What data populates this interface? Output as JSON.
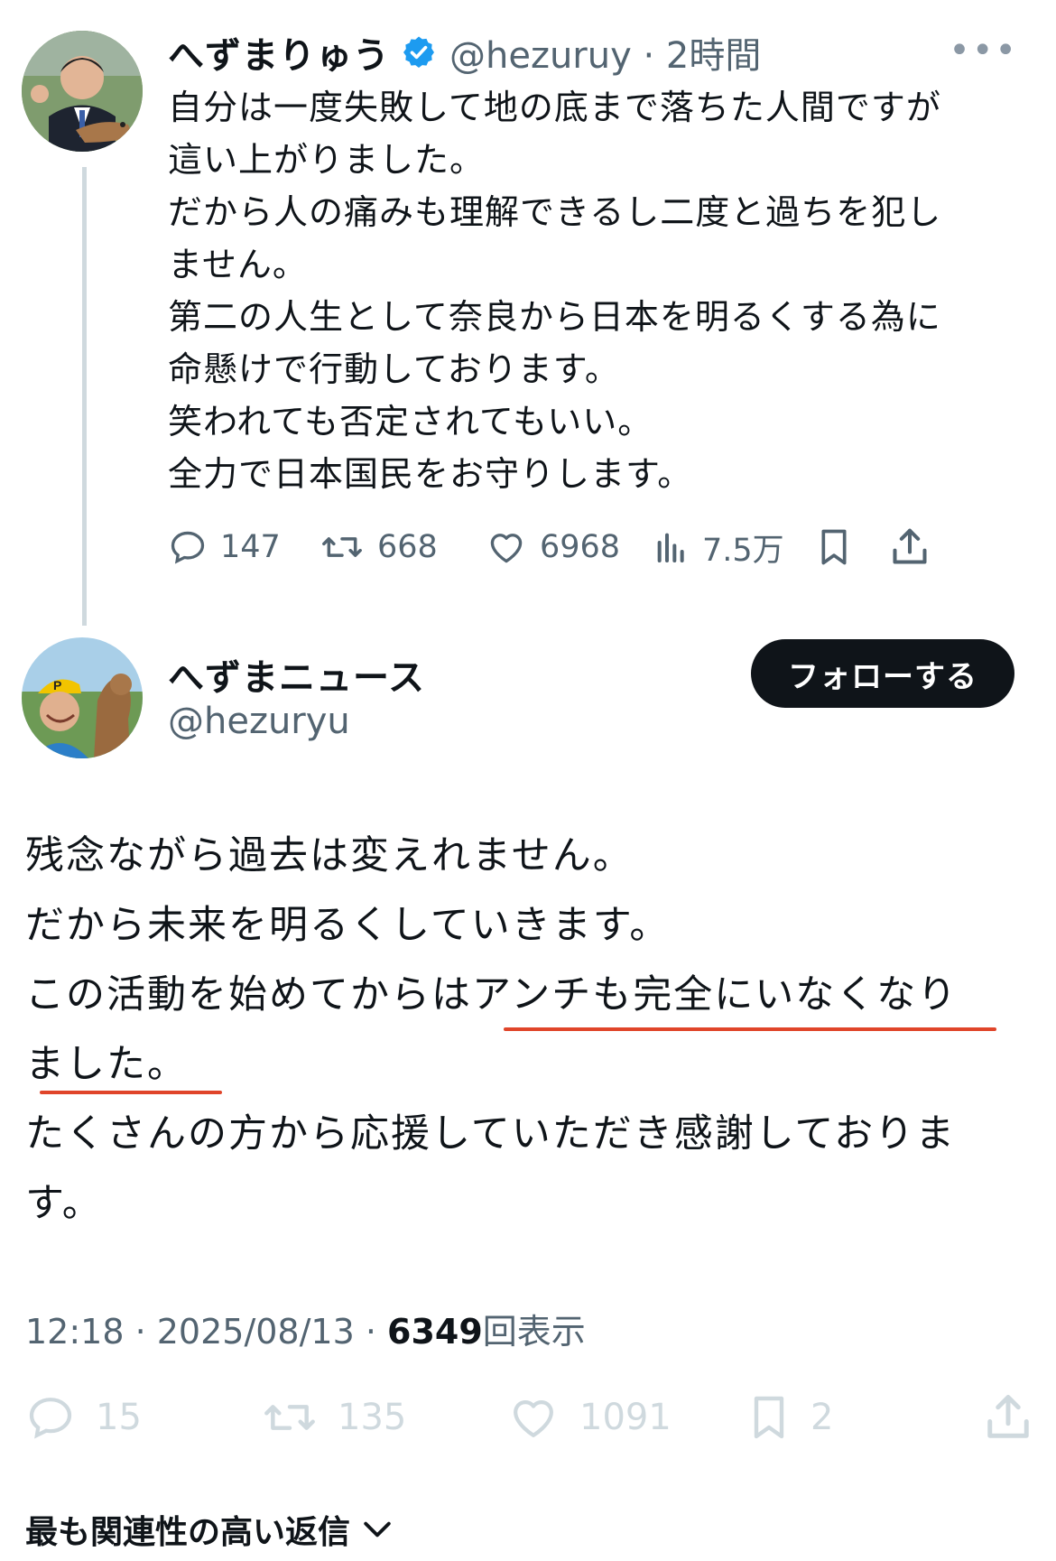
{
  "post1": {
    "display_name": "へずまりゅう",
    "handle_time": "@hezuruy · 2時間",
    "lines": [
      "自分は一度失敗して地の底まで落ちた人間ですが",
      "這い上がりました。",
      "だから人の痛みも理解できるし二度と過ちを犯し",
      "ません。",
      "第二の人生として奈良から日本を明るくする為に",
      "命懸けで行動しております。",
      "笑われても否定されてもいい。",
      "全力で日本国民をお守りします。"
    ],
    "replies": "147",
    "reposts": "668",
    "likes": "6968",
    "views": "7.5万"
  },
  "post2": {
    "display_name": "へずまニュース",
    "handle": "@hezuryu",
    "follow_label": "フォローする",
    "lines": [
      "残念ながら過去は変えれません。",
      "だから未来を明るくしていきます。",
      "この活動を始めてからはアンチも完全にいなくなり",
      "ました。",
      "たくさんの方から応援していただき感謝しておりま",
      "す。"
    ],
    "time": "12:18 · 2025/08/13 · ",
    "view_count": "6349",
    "view_suffix": "回表示",
    "replies": "15",
    "reposts": "135",
    "likes": "1091",
    "bookmarks": "2"
  },
  "replies_sort_label": "最も関連性の高い返信",
  "colors": {
    "verified": "#1d9bf0",
    "underline": "#e0452a",
    "follow_button": "#0f1419"
  }
}
